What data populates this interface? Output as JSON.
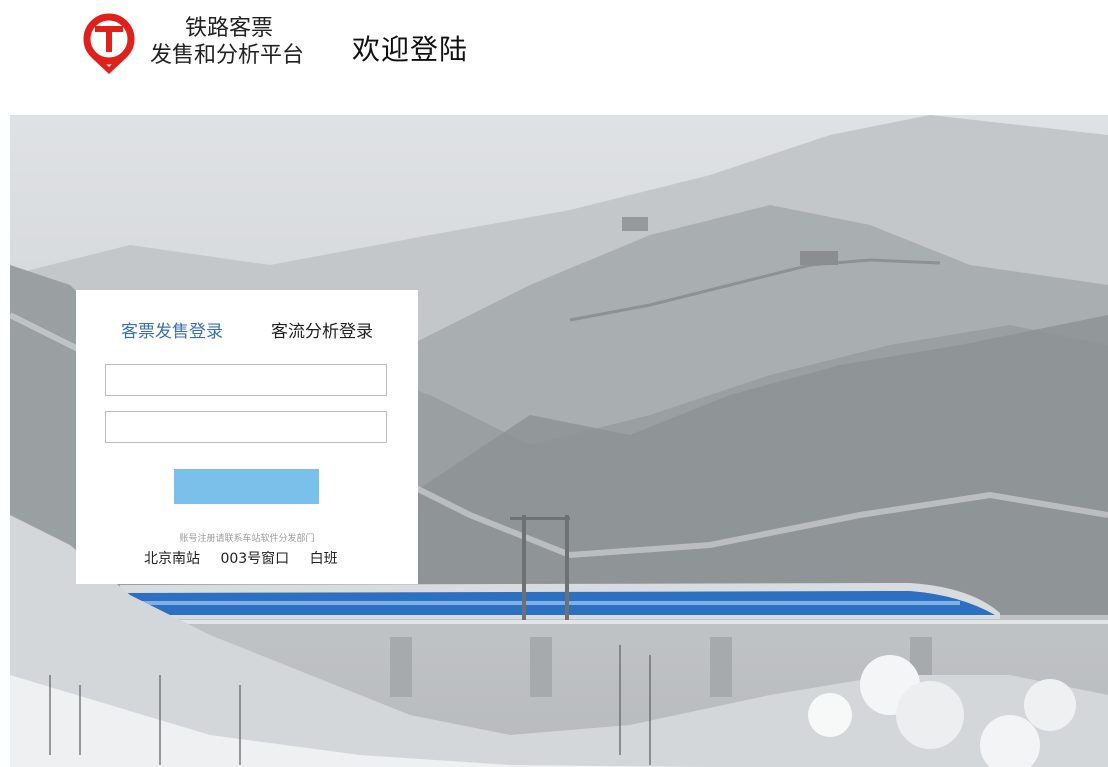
{
  "header": {
    "brand_line1": "铁路客票",
    "brand_line2": "发售和分析平台",
    "welcome": "欢迎登陆"
  },
  "colors": {
    "brand_red": "#e0201a",
    "active_tab": "#3a6fb7",
    "login_button": "#79c1ea"
  },
  "login": {
    "tabs": [
      {
        "label": "客票发售登录",
        "active": true
      },
      {
        "label": "客流分析登录",
        "active": false
      }
    ],
    "username": {
      "value": "",
      "placeholder": ""
    },
    "password": {
      "value": "",
      "placeholder": ""
    },
    "button_label": "",
    "hint": "账号注册请联系车站软件分发部门",
    "station": "北京南站",
    "window": "003号窗口",
    "shift": "白班"
  },
  "icons": {
    "logo": "china-railway-logo-icon"
  }
}
